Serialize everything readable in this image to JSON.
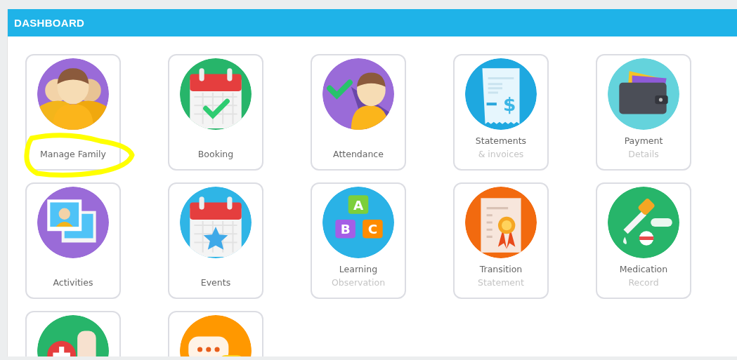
{
  "header": {
    "title": "DASHBOARD"
  },
  "tiles": [
    {
      "kind": "family",
      "label": "Manage Family",
      "highlighted": true
    },
    {
      "kind": "calendar-check",
      "label": "Booking",
      "highlighted": false
    },
    {
      "kind": "attendance",
      "label": "Attendance",
      "highlighted": false
    },
    {
      "kind": "receipt",
      "label": "Statements",
      "sublabel": "& invoices",
      "icon_text": "$",
      "highlighted": false
    },
    {
      "kind": "wallet",
      "label": "Payment",
      "sublabel": "Details",
      "highlighted": false
    },
    {
      "kind": "photos",
      "label": "Activities",
      "highlighted": false
    },
    {
      "kind": "calendar-star",
      "label": "Events",
      "highlighted": false
    },
    {
      "kind": "blocks",
      "label": "Learning",
      "sublabel": "Observation",
      "icon_letters": [
        "A",
        "B",
        "C"
      ],
      "highlighted": false
    },
    {
      "kind": "certificate",
      "label": "Transition",
      "sublabel": "Statement",
      "highlighted": false
    },
    {
      "kind": "medicine",
      "label": "Medication",
      "sublabel": "Record",
      "highlighted": false
    },
    {
      "kind": "first-aid",
      "highlighted": false
    },
    {
      "kind": "chat",
      "highlighted": false
    }
  ]
}
